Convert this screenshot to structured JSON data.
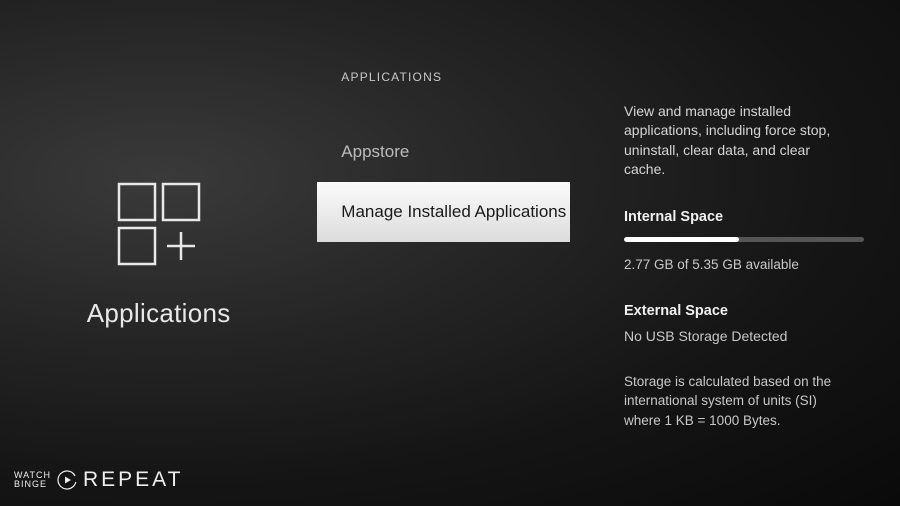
{
  "left": {
    "title": "Applications"
  },
  "menu": {
    "header": "APPLICATIONS",
    "items": [
      {
        "label": "Appstore"
      },
      {
        "label": "Manage Installed Applications"
      }
    ]
  },
  "details": {
    "description": "View and manage installed applications, including force stop, uninstall, clear data, and clear cache.",
    "internal": {
      "heading": "Internal Space",
      "available_gb": 2.77,
      "total_gb": 5.35,
      "text": "2.77 GB of 5.35 GB available",
      "fill_percent": 48
    },
    "external": {
      "heading": "External Space",
      "text": "No USB Storage Detected"
    },
    "footnote": "Storage is calculated based on the international system of units (SI) where 1 KB = 1000 Bytes."
  },
  "watermark": {
    "line1": "WATCH",
    "line2": "BINGE",
    "repeat": "REPEAT"
  }
}
